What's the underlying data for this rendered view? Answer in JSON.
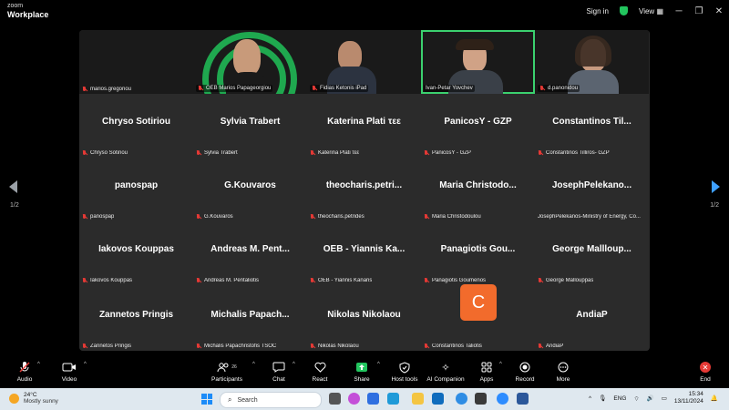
{
  "titlebar": {
    "brand_small": "zoom",
    "brand_big": "Workplace",
    "sign_in": "Sign in",
    "view": "View",
    "minimize": "─",
    "maximize": "❐",
    "close": "✕"
  },
  "tiles": [
    {
      "name": "",
      "label": "marios.gregoriou",
      "type": "blank"
    },
    {
      "name": "",
      "label": "OEB Marios Papageorgiou",
      "type": "video1"
    },
    {
      "name": "",
      "label": "Fidias Ketonis iPad",
      "type": "video2"
    },
    {
      "name": "",
      "label": "Ivan-Petar Yovchev",
      "type": "video3"
    },
    {
      "name": "",
      "label": "d.panonidou",
      "type": "video4"
    },
    {
      "name": "Chryso Sotiriou",
      "label": "Chryso Sotiriou"
    },
    {
      "name": "Sylvia Trabert",
      "label": "Sylvia Trabert"
    },
    {
      "name": "Katerina Plati τεε",
      "label": "Katerina Plati τεε"
    },
    {
      "name": "PanicosY - GZP",
      "label": "PanicosY - GZP"
    },
    {
      "name": "Constantinos Til...",
      "label": "Constantinos Tilliros- GZP"
    },
    {
      "name": "panospap",
      "label": "panospap"
    },
    {
      "name": "G.Kouvaros",
      "label": "G.Kouvaros"
    },
    {
      "name": "theocharis.petri...",
      "label": "theocharis.petrides"
    },
    {
      "name": "Maria Christodo...",
      "label": "Maria Christodoulou"
    },
    {
      "name": "JosephPelekano...",
      "label": "JosephPelekanos-Ministry of Energy, Co..."
    },
    {
      "name": "Iakovos Kouppas",
      "label": "Iakovos Kouppas"
    },
    {
      "name": "Andreas M. Pent...",
      "label": "Andreas M. Pentaliotis"
    },
    {
      "name": "OEB - Yiannis Ka...",
      "label": "OEB - Yiannis Kanaris"
    },
    {
      "name": "Panagiotis Gou...",
      "label": "Panagiotis Goumenos"
    },
    {
      "name": "George Mallloup...",
      "label": "George Mallouppas"
    },
    {
      "name": "Zannetos Pringis",
      "label": "Zannetos Pringis"
    },
    {
      "name": "Michalis Papach...",
      "label": "Michalis Papachristofis TSOC"
    },
    {
      "name": "Nikolas Nikolaou",
      "label": "Nikolas Nikolaou"
    },
    {
      "name": "",
      "label": "Constantinos Taliotis",
      "type": "avatar",
      "avatar_letter": "C",
      "avatar_color": "#f26b2c"
    },
    {
      "name": "AndiaP",
      "label": "AndiaP"
    }
  ],
  "pagination": {
    "left": "1/2",
    "right": "1/2"
  },
  "toolbar": {
    "audio": "Audio",
    "video": "Video",
    "participants": "Participants",
    "participants_count": "26",
    "chat": "Chat",
    "react": "React",
    "share": "Share",
    "host_tools": "Host tools",
    "ai_companion": "AI Companion",
    "apps": "Apps",
    "record": "Record",
    "more": "More",
    "end": "End"
  },
  "taskbar": {
    "temp": "24°C",
    "weather": "Mostly sunny",
    "search_placeholder": "Search",
    "lang": "ENG",
    "time": "15:34",
    "date": "13/11/2024"
  },
  "colors": {
    "active_speaker": "#3bd16f",
    "share_green": "#22c55e",
    "end_red": "#e53935",
    "nav_active": "#3ea0ff"
  }
}
